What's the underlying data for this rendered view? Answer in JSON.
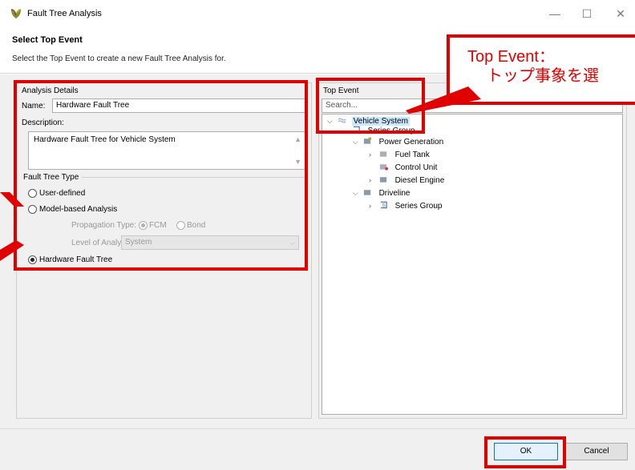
{
  "window": {
    "title": "Fault Tree Analysis",
    "minimize": "—",
    "maximize": "☐",
    "close": "✕"
  },
  "header": {
    "title": "Select Top Event",
    "description": "Select the Top Event to create a new Fault Tree Analysis for."
  },
  "details": {
    "group_label": "Analysis Details",
    "name_label": "Name:",
    "name_value": "Hardware Fault Tree",
    "description_label": "Description:",
    "description_value": "Hardware Fault Tree for Vehicle System",
    "type_label": "Fault Tree Type",
    "options": {
      "user_defined": "User-defined",
      "model_based": "Model-based Analysis",
      "hardware": "Hardware Fault Tree"
    },
    "propagation_label": "Propagation Type:",
    "propagation_fcm": "FCM",
    "propagation_bond": "Bond",
    "level_label": "Level of Analysis:",
    "level_value": "System"
  },
  "top_event": {
    "group_label": "Top Event",
    "search_placeholder": "Search...",
    "tree": [
      {
        "label": "Vehicle System",
        "level": 0,
        "twisty": "v",
        "selected": true
      },
      {
        "label": "Series Group",
        "level": 1,
        "twisty": "v"
      },
      {
        "label": "Power Generation",
        "level": 2,
        "twisty": "v"
      },
      {
        "label": "Fuel Tank",
        "level": 3,
        "twisty": ">"
      },
      {
        "label": "Control Unit",
        "level": 3,
        "twisty": ""
      },
      {
        "label": "Diesel Engine",
        "level": 3,
        "twisty": ">"
      },
      {
        "label": "Driveline",
        "level": 2,
        "twisty": "v"
      },
      {
        "label": "Series Group",
        "level": 3,
        "twisty": ">"
      }
    ]
  },
  "footer": {
    "ok_label": "OK",
    "cancel_label": "Cancel"
  },
  "annotation": {
    "line1": "Top Event：",
    "line2": "トップ事象を選"
  },
  "colors": {
    "highlight_red": "#e00000",
    "selection_blue": "#cce8ff"
  }
}
